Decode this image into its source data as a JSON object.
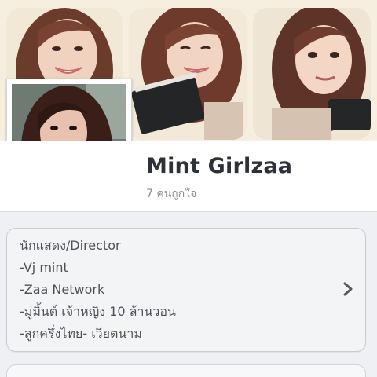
{
  "profile": {
    "name": "Mint Girlzaa",
    "likes_text": "7 คนถูกใจ"
  },
  "about": {
    "lines": [
      "นักแสดง/Director",
      "-Vj mint",
      "-Zaa Network",
      "-มู่มิ้นต์ เจ้าหญิง 10 ล้านวอน",
      "-ลูกครึ่งไทย- เวียตนาม"
    ]
  },
  "icons": {
    "about_chevron": "chevron-right-icon"
  },
  "colors": {
    "cover_background": "#f6efdf",
    "name_text": "#2f3138",
    "secondary_text": "#8a8e96",
    "card_background": "#f3f4f6"
  }
}
